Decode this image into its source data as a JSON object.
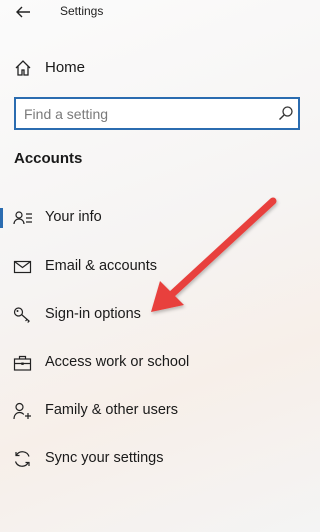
{
  "window": {
    "title": "Settings"
  },
  "header": {
    "home_label": "Home"
  },
  "search": {
    "placeholder": "Find a setting"
  },
  "section": {
    "title": "Accounts"
  },
  "nav": {
    "items": [
      {
        "label": "Your info",
        "icon": "person-card-icon",
        "active": true
      },
      {
        "label": "Email & accounts",
        "icon": "envelope-icon"
      },
      {
        "label": "Sign-in options",
        "icon": "key-icon"
      },
      {
        "label": "Access work or school",
        "icon": "briefcase-icon"
      },
      {
        "label": "Family & other users",
        "icon": "person-add-icon"
      },
      {
        "label": "Sync your settings",
        "icon": "sync-icon"
      }
    ]
  },
  "annotation": {
    "arrow_color": "#e8413d",
    "points_to": "Sign-in options"
  },
  "colors": {
    "accent": "#2b6cb0"
  }
}
